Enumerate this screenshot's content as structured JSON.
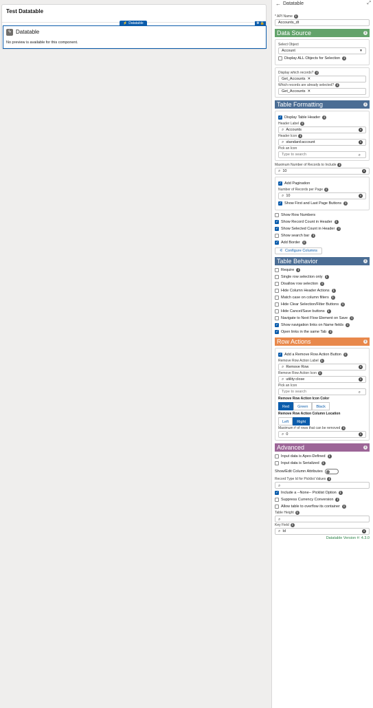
{
  "canvas": {
    "title": "Test Datatable",
    "badge": "Datatable",
    "component_name": "Datatable",
    "note": "No preview is available for this component."
  },
  "panel": {
    "title": "Datatable",
    "api_name_label": "* API Name",
    "api_name_value": "Accounts_dt",
    "sections": {
      "data_source": "Data Source",
      "table_formatting": "Table Formatting",
      "table_behavior": "Table Behavior",
      "row_actions": "Row Actions",
      "advanced": "Advanced"
    },
    "data_source": {
      "select_object_label": "Select Object",
      "select_object_value": "Account",
      "display_all_objects": "Display ALL Objects for Selection",
      "display_records_label": "Display which records?",
      "display_records_value": "Get_Accounts",
      "selected_records_label": "Which records are already selected?",
      "selected_records_value": "Get_Accounts"
    },
    "formatting": {
      "display_table_header": "Display Table Header",
      "header_label_label": "Header Label",
      "header_label_value": "Accounts",
      "header_icon_label": "Header Icon",
      "header_icon_value": "standard:account",
      "pick_icon_label": "Pick an Icon",
      "pick_icon_placeholder": "Type to search",
      "max_records_label": "Maximum Number of Records to Include",
      "max_records_value": "10",
      "add_pagination": "Add Pagination",
      "records_per_page_label": "Number of Records per Page",
      "records_per_page_value": "10",
      "show_first_last": "Show First and Last Page Buttons",
      "show_row_numbers": "Show Row Numbers",
      "show_record_count": "Show Record Count in Header",
      "show_selected_count": "Show Selected Count in Header",
      "show_search_bar": "Show search bar",
      "add_border": "Add Border",
      "configure_columns": "Configure Columns"
    },
    "behavior": {
      "require": "Require",
      "single_row": "Single row selection only",
      "disallow_row": "Disallow row selection",
      "hide_column_header": "Hide Column Header Actions",
      "match_case": "Match case on column filters",
      "hide_clear": "Hide Clear Selection/Filter Buttons",
      "hide_cancel": "Hide Cancel/Save buttons",
      "navigate_next": "Navigate to Next Flow Element on Save",
      "show_nav_links": "Show navigation links on Name fields",
      "open_links": "Open links in the same Tab"
    },
    "row_actions": {
      "add_remove": "Add a Remove Row Action Button",
      "remove_label_label": "Remove Row Action Label",
      "remove_label_value": "Remove Row",
      "remove_icon_label": "Remove Row Action Icon",
      "remove_icon_value": "utility:close",
      "pick_icon_label": "Pick an Icon",
      "pick_icon_placeholder": "Type to search",
      "icon_color_label": "Remove Row Action Icon Color",
      "color_options": [
        "Red",
        "Green",
        "Black"
      ],
      "column_location_label": "Remove Row Action Column Location",
      "location_options": [
        "Left",
        "Right"
      ],
      "max_rows_label": "Maximum # of rows that can be removed",
      "max_rows_value": "0"
    },
    "advanced": {
      "apex_defined": "Input data is Apex-Defined",
      "serialized": "Input data is Serialized",
      "show_edit_column": "Show/Edit Column Attributes",
      "record_type_label": "Record Type Id for Picklist Values",
      "include_none": "Include a --None-- Picklist Option",
      "suppress_currency": "Suppress Currency Conversion",
      "allow_overflow": "Allow table to overflow its container",
      "table_height_label": "Table Height",
      "key_field_label": "Key Field",
      "key_field_value": "Id",
      "version": "Datatable Version #: 4.3.0"
    }
  }
}
